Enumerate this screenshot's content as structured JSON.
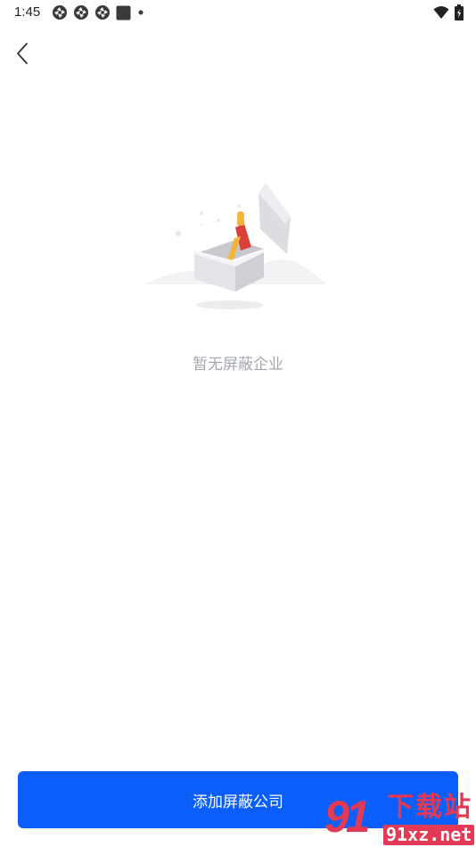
{
  "status_bar": {
    "time": "1:45",
    "notification_icons": [
      "aperture-icon",
      "aperture-icon",
      "aperture-icon",
      "square-app-icon",
      "dot-icon"
    ],
    "system_icons": [
      "wifi-icon",
      "battery-charging-icon"
    ]
  },
  "nav": {
    "back_icon": "chevron-left-icon"
  },
  "empty_state": {
    "illustration": "open-box-illustration",
    "message": "暂无屏蔽企业"
  },
  "footer": {
    "add_button_label": "添加屏蔽公司"
  },
  "watermark": {
    "logo_text": "91",
    "title": "下载站",
    "url": "91xz.net"
  },
  "colors": {
    "primary": "#0a5efb",
    "empty_text": "#a4a8b0",
    "watermark": "#e23a54"
  }
}
